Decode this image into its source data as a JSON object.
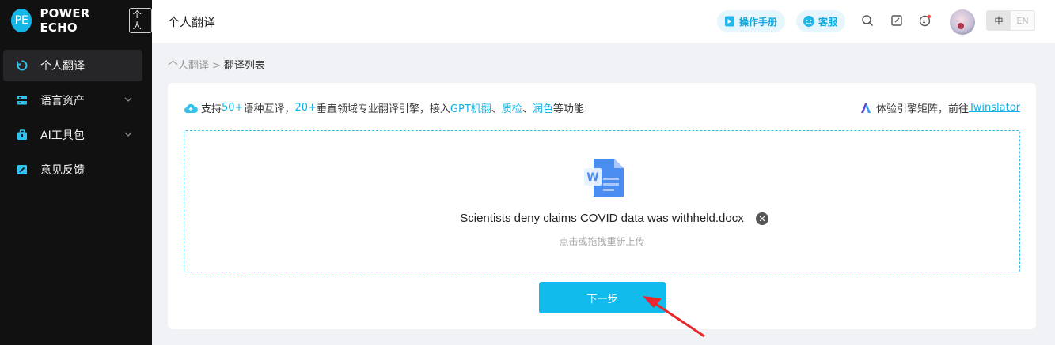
{
  "app": {
    "logo_badge": "PE",
    "brand": "POWER ECHO",
    "tag": "个人"
  },
  "sidebar": {
    "items": [
      {
        "label": "个人翻译",
        "icon": "refresh-icon",
        "active": true
      },
      {
        "label": "语言资产",
        "icon": "database-icon",
        "expandable": true
      },
      {
        "label": "AI工具包",
        "icon": "toolbox-icon",
        "expandable": true
      },
      {
        "label": "意见反馈",
        "icon": "edit-icon"
      }
    ]
  },
  "header": {
    "title": "个人翻译",
    "manual_label": "操作手册",
    "service_label": "客服",
    "lang_zh": "中",
    "lang_en": "EN"
  },
  "breadcrumb": {
    "parent": "个人翻译",
    "separator": ">",
    "current": "翻译列表"
  },
  "card": {
    "info": {
      "p1": "支持",
      "h1": "50+",
      "p2": "语种互译，",
      "h2": "20+",
      "p3": "垂直领域专业翻译引擎，接入",
      "h3": "GPT机翻",
      "p4": "、",
      "h4": "质检",
      "p5": "、",
      "h5": "润色",
      "p6": "等功能"
    },
    "right": {
      "text": "体验引擎矩阵，前往",
      "link": "Twinslator"
    },
    "upload": {
      "file_name": "Scientists deny claims COVID data was withheld.docx",
      "hint": "点击或拖拽重新上传"
    },
    "next_label": "下一步"
  },
  "colors": {
    "accent": "#11bcec",
    "sidebar_bg": "#111112",
    "page_bg": "#f0f2f5"
  }
}
